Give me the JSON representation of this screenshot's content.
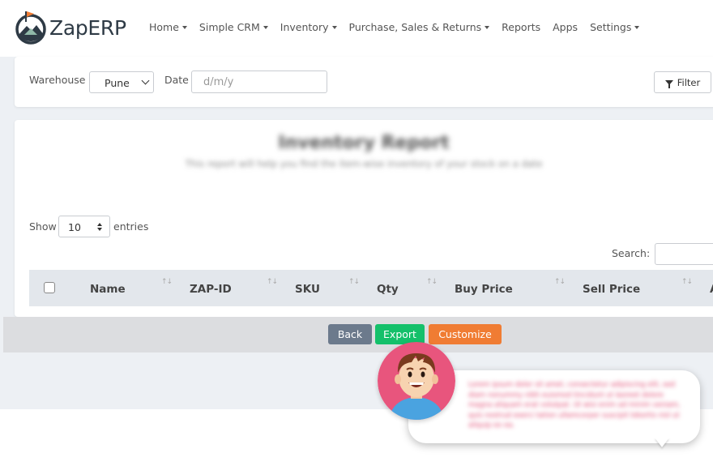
{
  "brand": {
    "name": "ZapERP"
  },
  "nav": [
    {
      "label": "Home",
      "dropdown": true
    },
    {
      "label": "Simple CRM",
      "dropdown": true
    },
    {
      "label": "Inventory",
      "dropdown": true
    },
    {
      "label": "Purchase, Sales & Returns",
      "dropdown": true
    },
    {
      "label": "Reports",
      "dropdown": false
    },
    {
      "label": "Apps",
      "dropdown": false
    },
    {
      "label": "Settings",
      "dropdown": true
    }
  ],
  "filters": {
    "warehouse_label": "Warehouse",
    "warehouse_value": "Pune",
    "date_label": "Date",
    "date_placeholder": "d/m/y",
    "filter_button": "Filter"
  },
  "report": {
    "title": "Inventory Report",
    "subtitle": "This report will help you find the item-wise inventory of your stock on a date"
  },
  "table": {
    "show_label": "Show",
    "entries_value": "10",
    "entries_label": "entries",
    "search_label": "Search:",
    "columns": [
      "Name",
      "ZAP-ID",
      "SKU",
      "Qty",
      "Buy Price",
      "Sell Price",
      "A"
    ]
  },
  "actions": {
    "back": "Back",
    "export": "Export",
    "customize": "Customize"
  },
  "assistant": {
    "message": "Lorem ipsum dolor sit amet, consectetur adipiscing elit, sed diam nonummy nibh euismod tincidunt ut laoreet dolore magna aliquam erat volutpat. Ut wisi enim ad minim veniam, quis nostrud exerci tation ullamcorper suscipit lobortis nisl ut aliquip ex ea."
  },
  "colors": {
    "back": "#6c7a8c",
    "export": "#14c06a",
    "customize": "#f07c33",
    "avatar_bg": "#e8557d",
    "assistant_text": "#e0406a"
  }
}
